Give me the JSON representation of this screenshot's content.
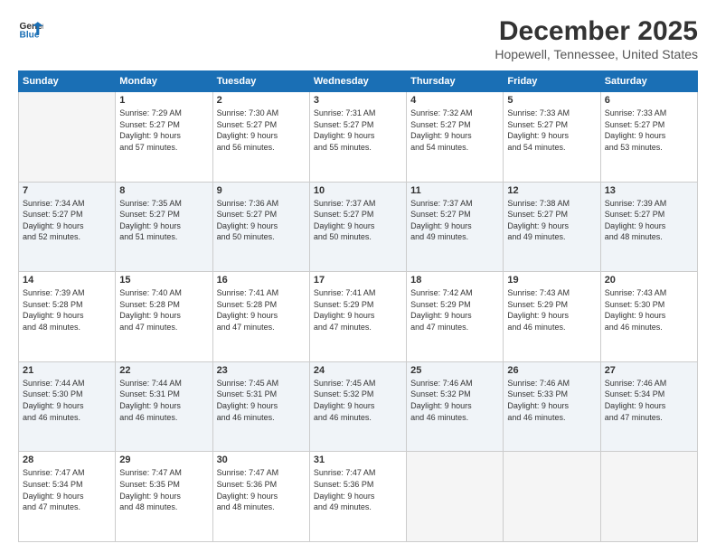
{
  "logo": {
    "line1": "General",
    "line2": "Blue"
  },
  "title": "December 2025",
  "subtitle": "Hopewell, Tennessee, United States",
  "days_header": [
    "Sunday",
    "Monday",
    "Tuesday",
    "Wednesday",
    "Thursday",
    "Friday",
    "Saturday"
  ],
  "weeks": [
    [
      {
        "num": "",
        "info": ""
      },
      {
        "num": "1",
        "info": "Sunrise: 7:29 AM\nSunset: 5:27 PM\nDaylight: 9 hours\nand 57 minutes."
      },
      {
        "num": "2",
        "info": "Sunrise: 7:30 AM\nSunset: 5:27 PM\nDaylight: 9 hours\nand 56 minutes."
      },
      {
        "num": "3",
        "info": "Sunrise: 7:31 AM\nSunset: 5:27 PM\nDaylight: 9 hours\nand 55 minutes."
      },
      {
        "num": "4",
        "info": "Sunrise: 7:32 AM\nSunset: 5:27 PM\nDaylight: 9 hours\nand 54 minutes."
      },
      {
        "num": "5",
        "info": "Sunrise: 7:33 AM\nSunset: 5:27 PM\nDaylight: 9 hours\nand 54 minutes."
      },
      {
        "num": "6",
        "info": "Sunrise: 7:33 AM\nSunset: 5:27 PM\nDaylight: 9 hours\nand 53 minutes."
      }
    ],
    [
      {
        "num": "7",
        "info": "Sunrise: 7:34 AM\nSunset: 5:27 PM\nDaylight: 9 hours\nand 52 minutes."
      },
      {
        "num": "8",
        "info": "Sunrise: 7:35 AM\nSunset: 5:27 PM\nDaylight: 9 hours\nand 51 minutes."
      },
      {
        "num": "9",
        "info": "Sunrise: 7:36 AM\nSunset: 5:27 PM\nDaylight: 9 hours\nand 50 minutes."
      },
      {
        "num": "10",
        "info": "Sunrise: 7:37 AM\nSunset: 5:27 PM\nDaylight: 9 hours\nand 50 minutes."
      },
      {
        "num": "11",
        "info": "Sunrise: 7:37 AM\nSunset: 5:27 PM\nDaylight: 9 hours\nand 49 minutes."
      },
      {
        "num": "12",
        "info": "Sunrise: 7:38 AM\nSunset: 5:27 PM\nDaylight: 9 hours\nand 49 minutes."
      },
      {
        "num": "13",
        "info": "Sunrise: 7:39 AM\nSunset: 5:27 PM\nDaylight: 9 hours\nand 48 minutes."
      }
    ],
    [
      {
        "num": "14",
        "info": "Sunrise: 7:39 AM\nSunset: 5:28 PM\nDaylight: 9 hours\nand 48 minutes."
      },
      {
        "num": "15",
        "info": "Sunrise: 7:40 AM\nSunset: 5:28 PM\nDaylight: 9 hours\nand 47 minutes."
      },
      {
        "num": "16",
        "info": "Sunrise: 7:41 AM\nSunset: 5:28 PM\nDaylight: 9 hours\nand 47 minutes."
      },
      {
        "num": "17",
        "info": "Sunrise: 7:41 AM\nSunset: 5:29 PM\nDaylight: 9 hours\nand 47 minutes."
      },
      {
        "num": "18",
        "info": "Sunrise: 7:42 AM\nSunset: 5:29 PM\nDaylight: 9 hours\nand 47 minutes."
      },
      {
        "num": "19",
        "info": "Sunrise: 7:43 AM\nSunset: 5:29 PM\nDaylight: 9 hours\nand 46 minutes."
      },
      {
        "num": "20",
        "info": "Sunrise: 7:43 AM\nSunset: 5:30 PM\nDaylight: 9 hours\nand 46 minutes."
      }
    ],
    [
      {
        "num": "21",
        "info": "Sunrise: 7:44 AM\nSunset: 5:30 PM\nDaylight: 9 hours\nand 46 minutes."
      },
      {
        "num": "22",
        "info": "Sunrise: 7:44 AM\nSunset: 5:31 PM\nDaylight: 9 hours\nand 46 minutes."
      },
      {
        "num": "23",
        "info": "Sunrise: 7:45 AM\nSunset: 5:31 PM\nDaylight: 9 hours\nand 46 minutes."
      },
      {
        "num": "24",
        "info": "Sunrise: 7:45 AM\nSunset: 5:32 PM\nDaylight: 9 hours\nand 46 minutes."
      },
      {
        "num": "25",
        "info": "Sunrise: 7:46 AM\nSunset: 5:32 PM\nDaylight: 9 hours\nand 46 minutes."
      },
      {
        "num": "26",
        "info": "Sunrise: 7:46 AM\nSunset: 5:33 PM\nDaylight: 9 hours\nand 46 minutes."
      },
      {
        "num": "27",
        "info": "Sunrise: 7:46 AM\nSunset: 5:34 PM\nDaylight: 9 hours\nand 47 minutes."
      }
    ],
    [
      {
        "num": "28",
        "info": "Sunrise: 7:47 AM\nSunset: 5:34 PM\nDaylight: 9 hours\nand 47 minutes."
      },
      {
        "num": "29",
        "info": "Sunrise: 7:47 AM\nSunset: 5:35 PM\nDaylight: 9 hours\nand 48 minutes."
      },
      {
        "num": "30",
        "info": "Sunrise: 7:47 AM\nSunset: 5:36 PM\nDaylight: 9 hours\nand 48 minutes."
      },
      {
        "num": "31",
        "info": "Sunrise: 7:47 AM\nSunset: 5:36 PM\nDaylight: 9 hours\nand 49 minutes."
      },
      {
        "num": "",
        "info": ""
      },
      {
        "num": "",
        "info": ""
      },
      {
        "num": "",
        "info": ""
      }
    ]
  ]
}
